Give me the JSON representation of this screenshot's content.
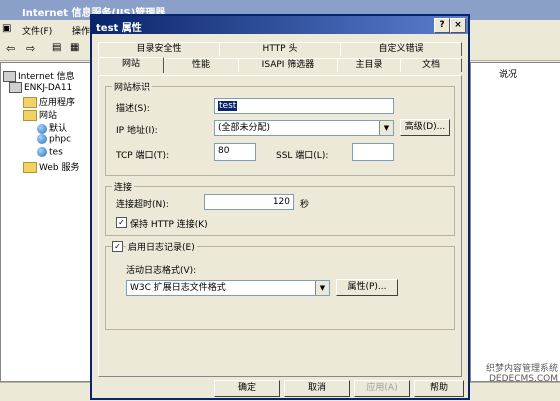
{
  "background_window": {
    "title": "Internet 信息服务(IIS)管理器",
    "menu": [
      "文件(F)",
      "操作"
    ],
    "right_header": "说况",
    "tree": [
      "Internet 信息",
      "ENKJ-DA11",
      "应用程序",
      "网站",
      "默认",
      "phpc",
      "tes",
      "Web 服务"
    ]
  },
  "dialog": {
    "title": "test 属性",
    "tabs_row1": [
      "目录安全性",
      "HTTP 头",
      "自定义错误"
    ],
    "tabs_row2": [
      "网站",
      "性能",
      "ISAPI 筛选器",
      "主目录",
      "文档"
    ],
    "active_tab": "网站",
    "site_id_group": {
      "label": "网站标识",
      "desc_label": "描述(S):",
      "desc_value": "test",
      "ip_label": "IP 地址(I):",
      "ip_value": "(全部未分配)",
      "advanced_button": "高级(D)...",
      "tcp_label": "TCP 端口(T):",
      "tcp_value": "80",
      "ssl_label": "SSL 端口(L):",
      "ssl_value": ""
    },
    "connection_group": {
      "label": "连接",
      "timeout_label": "连接超时(N):",
      "timeout_value": "120",
      "timeout_unit": "秒",
      "keepalive_label": "保持 HTTP 连接(K)",
      "keepalive_checked": true
    },
    "logging_group": {
      "label": "启用日志记录(E)",
      "checked": true,
      "format_label": "活动日志格式(V):",
      "format_value": "W3C 扩展日志文件格式",
      "properties_button": "属性(P)..."
    },
    "buttons": {
      "ok": "确定",
      "cancel": "取消",
      "apply": "应用(A)",
      "help": "帮助"
    }
  },
  "watermark": {
    "line1": "织梦内容管理系统",
    "line2": "DEDECMS.COM"
  }
}
